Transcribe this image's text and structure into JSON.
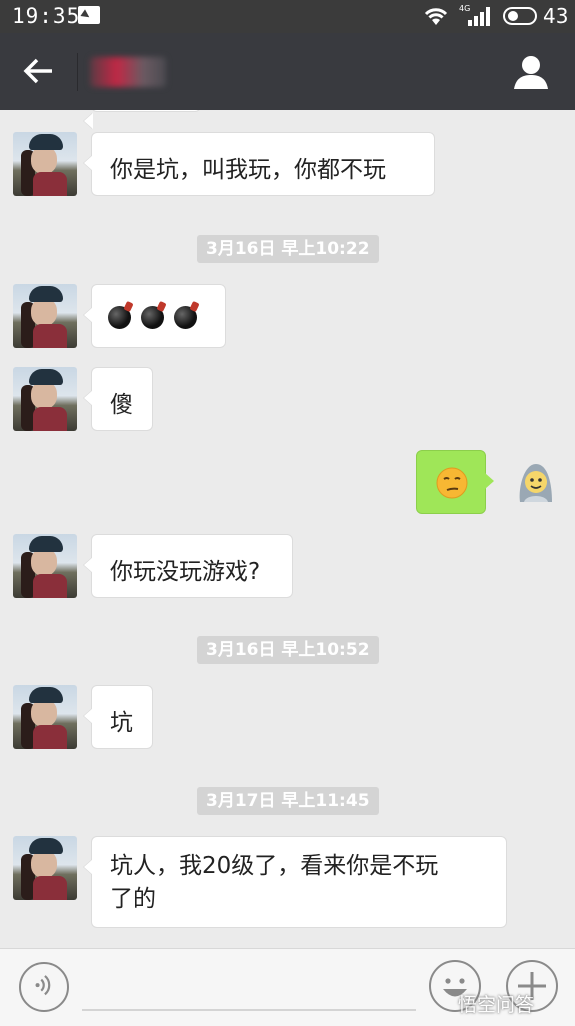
{
  "status_bar": {
    "time": "19:35",
    "network": "4G",
    "battery": "43"
  },
  "header": {
    "back_icon": "arrow-left-icon",
    "contact_name": "",
    "profile_icon": "person-icon"
  },
  "messages": [
    {
      "type": "text",
      "side": "left",
      "text": "你是坑，叫我玩，你都不玩"
    },
    {
      "type": "timestamp",
      "text": "3月16日 早上10:22"
    },
    {
      "type": "emoji",
      "side": "left",
      "emoji": "bomb-icon",
      "count": 3
    },
    {
      "type": "text",
      "side": "left",
      "text": "傻"
    },
    {
      "type": "emoji",
      "side": "right",
      "emoji": "smirk-face-icon"
    },
    {
      "type": "text",
      "side": "left",
      "text": "你玩没玩游戏?"
    },
    {
      "type": "timestamp",
      "text": "3月16日 早上10:52"
    },
    {
      "type": "text",
      "side": "left",
      "text": "坑"
    },
    {
      "type": "timestamp",
      "text": "3月17日 早上11:45"
    },
    {
      "type": "text",
      "side": "left",
      "text_line1": "坑人，我20级了，看来你是不玩",
      "text_line2": "了的"
    }
  ],
  "input_bar": {
    "voice_icon": "voice-icon",
    "emoji_icon": "smile-icon",
    "plus_icon": "plus-icon"
  },
  "watermark": "悟空问答",
  "colors": {
    "title_bar": "#393a3f",
    "chat_background": "#ebebeb",
    "outgoing_bubble": "#9fe658",
    "timestamp_bg": "#d4d4d4"
  }
}
